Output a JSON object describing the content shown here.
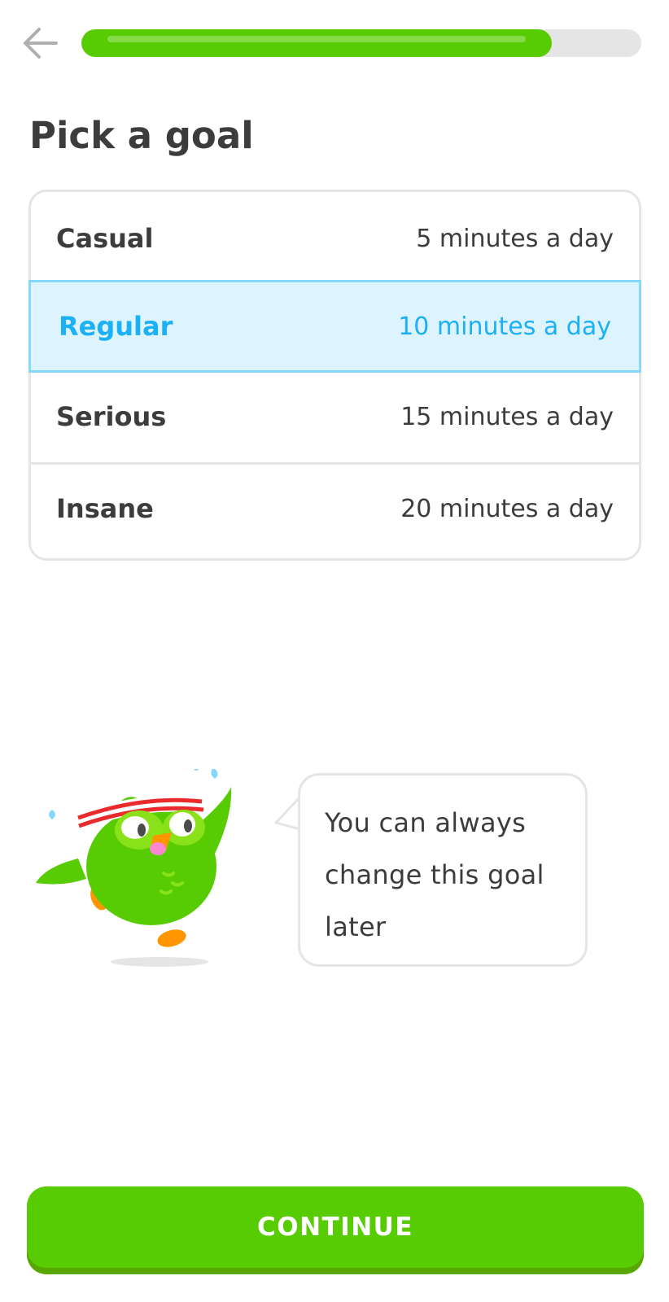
{
  "colors": {
    "brand_green": "#58cc02",
    "selected_blue": "#1cb0f6",
    "selected_bg": "#ddf4ff",
    "text": "#3c3c3c"
  },
  "header": {
    "back_icon": "arrow-left-icon",
    "progress_fraction": 0.84
  },
  "title": "Pick a goal",
  "goals": [
    {
      "name": "Casual",
      "duration": "5 minutes a day",
      "selected": false
    },
    {
      "name": "Regular",
      "duration": "10 minutes a day",
      "selected": true
    },
    {
      "name": "Serious",
      "duration": "15 minutes a day",
      "selected": false
    },
    {
      "name": "Insane",
      "duration": "20 minutes a day",
      "selected": false
    }
  ],
  "mascot_icon": "owl-mascot-icon",
  "speech": {
    "line1": "You can always",
    "line2": "change this goal",
    "line3": "later"
  },
  "continue_label": "CONTINUE"
}
